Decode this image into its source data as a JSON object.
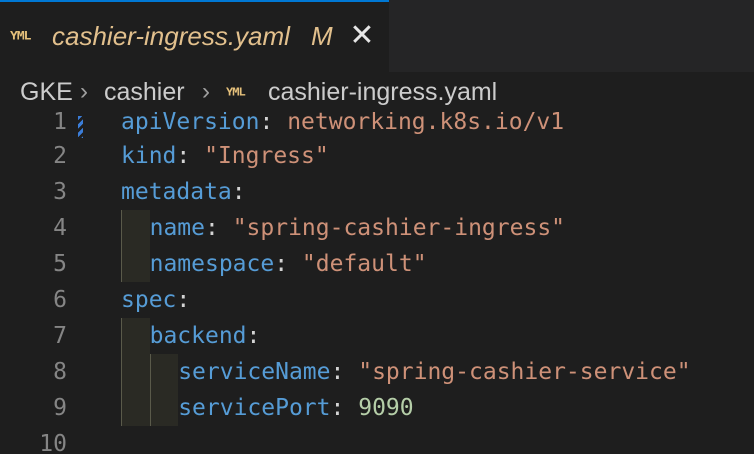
{
  "tab": {
    "icon": "yaml-file-icon",
    "icon_text": "YML",
    "filename": "cashier-ingress.yaml",
    "status": "M",
    "close": "✕"
  },
  "breadcrumb": {
    "items": [
      "GKE",
      "cashier",
      "cashier-ingress.yaml"
    ],
    "separator": "›"
  },
  "editor": {
    "lines": [
      {
        "num": "1",
        "key": "apiVersion",
        "colon": ": ",
        "value": "networking.k8s.io/v1",
        "vtype": "s"
      },
      {
        "num": "2",
        "key": "kind",
        "colon": ": ",
        "value": "\"Ingress\"",
        "vtype": "s"
      },
      {
        "num": "3",
        "key": "metadata",
        "colon": ":",
        "value": "",
        "vtype": "s"
      },
      {
        "num": "4",
        "key": "name",
        "colon": ": ",
        "value": "\"spring-cashier-ingress\"",
        "vtype": "s"
      },
      {
        "num": "5",
        "key": "namespace",
        "colon": ": ",
        "value": "\"default\"",
        "vtype": "s"
      },
      {
        "num": "6",
        "key": "spec",
        "colon": ":",
        "value": "",
        "vtype": "s"
      },
      {
        "num": "7",
        "key": "backend",
        "colon": ":",
        "value": "",
        "vtype": "s"
      },
      {
        "num": "8",
        "key": "serviceName",
        "colon": ": ",
        "value": "\"spring-cashier-service\"",
        "vtype": "s"
      },
      {
        "num": "9",
        "key": "servicePort",
        "colon": ": ",
        "value": "9090",
        "vtype": "n"
      },
      {
        "num": "10",
        "key": "",
        "colon": "",
        "value": "",
        "vtype": "s"
      }
    ]
  }
}
